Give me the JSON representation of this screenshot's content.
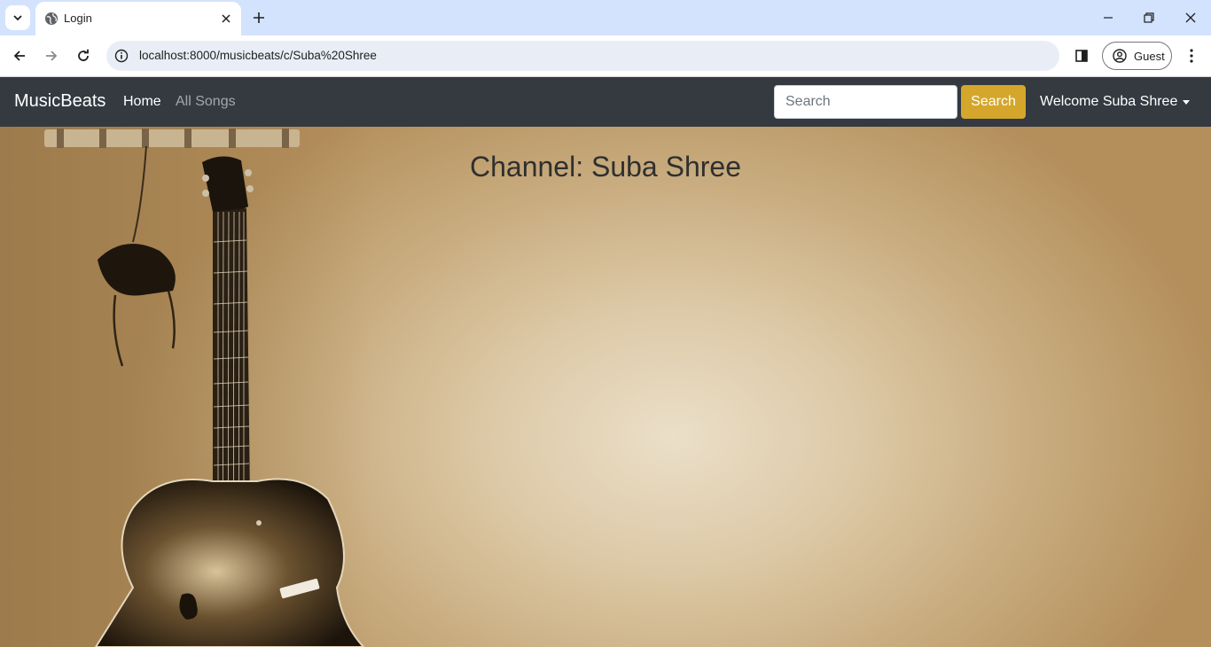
{
  "browser": {
    "tab_title": "Login",
    "url": "localhost:8000/musicbeats/c/Suba%20Shree",
    "profile_label": "Guest"
  },
  "navbar": {
    "brand": "MusicBeats",
    "links": [
      {
        "label": "Home",
        "active": true
      },
      {
        "label": "All Songs",
        "active": false
      }
    ],
    "search_placeholder": "Search",
    "search_button": "Search",
    "user_menu": "Welcome Suba Shree",
    "colors": {
      "navbar_bg": "#343a40",
      "search_button_bg": "#d4a72c"
    }
  },
  "main": {
    "heading": "Channel: Suba Shree",
    "background_image": "guitar-on-wall-sepia"
  }
}
